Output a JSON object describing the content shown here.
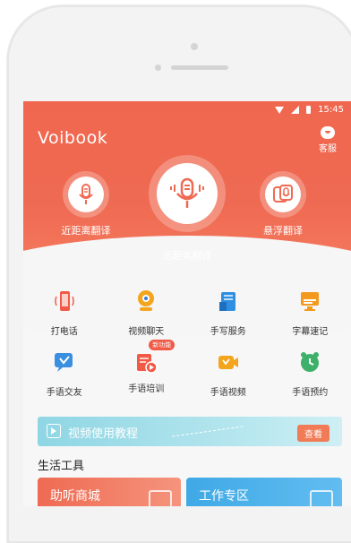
{
  "status": {
    "time": "15:45"
  },
  "header": {
    "app_title": "Voibook",
    "customer_service": "客服"
  },
  "modes": [
    {
      "label": "近距离翻译"
    },
    {
      "label": "远距离翻译"
    },
    {
      "label": "悬浮翻译"
    }
  ],
  "features": [
    {
      "label": "打电话"
    },
    {
      "label": "视频聊天"
    },
    {
      "label": "手写服务"
    },
    {
      "label": "字幕速记"
    },
    {
      "label": "手语交友"
    },
    {
      "label": "手语培训",
      "badge": "新功能"
    },
    {
      "label": "手语视频"
    },
    {
      "label": "手语预约"
    }
  ],
  "banner": {
    "text": "视频使用教程",
    "button": "查看"
  },
  "life_tools": {
    "title": "生活工具",
    "cards": [
      {
        "label": "助听商城"
      },
      {
        "label": "工作专区"
      }
    ]
  },
  "colors": {
    "accent": "#EF6A52",
    "blue": "#3FA9E6",
    "banner": "#8FD6E4"
  }
}
